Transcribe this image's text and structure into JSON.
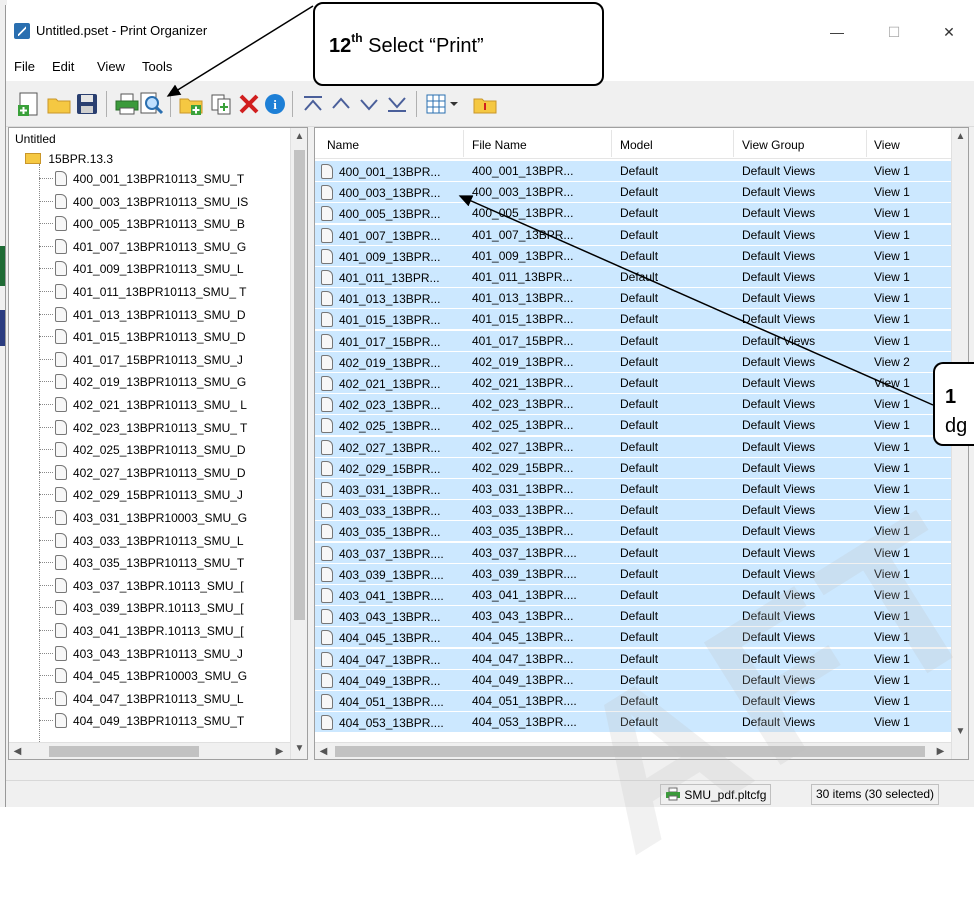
{
  "window": {
    "title": "Untitled.pset - Print Organizer",
    "minimize": "—",
    "maximize": "☐",
    "close": "✕"
  },
  "menu": [
    "File",
    "Edit",
    "View",
    "Tools"
  ],
  "toolbar": {
    "icons": [
      "new-icon",
      "open-icon",
      "save-icon",
      "print-icon",
      "preview-icon",
      "add-folder-icon",
      "add-files-icon",
      "delete-icon",
      "properties-icon",
      "move-top-icon",
      "move-up-icon",
      "move-down-icon",
      "move-bottom-icon",
      "columns-icon",
      "help-icon"
    ]
  },
  "callouts": {
    "step12_number": "12",
    "step12_suffix": "th",
    "step12_text": " Select “Print”",
    "step11_partial_top": "1",
    "step11_partial_bottom": "dg"
  },
  "tree": {
    "root": "Untitled",
    "project": "15BPR.13.3",
    "items": [
      "400_001_13BPR10113_SMU_T",
      "400_003_13BPR10113_SMU_IS",
      "400_005_13BPR10113_SMU_B",
      "401_007_13BPR10113_SMU_G",
      "401_009_13BPR10113_SMU_L",
      "401_011_13BPR10113_SMU_ T",
      "401_013_13BPR10113_SMU_D",
      "401_015_13BPR10113_SMU_D",
      "401_017_15BPR10113_SMU_J",
      "402_019_13BPR10113_SMU_G",
      "402_021_13BPR10113_SMU_ L",
      "402_023_13BPR10113_SMU_ T",
      "402_025_13BPR10113_SMU_D",
      "402_027_13BPR10113_SMU_D",
      "402_029_15BPR10113_SMU_J",
      "403_031_13BPR10003_SMU_G",
      "403_033_13BPR10113_SMU_L",
      "403_035_13BPR10113_SMU_T",
      "403_037_13BPR.10113_SMU_[",
      "403_039_13BPR.10113_SMU_[",
      "403_041_13BPR.10113_SMU_[",
      "403_043_13BPR10113_SMU_J",
      "404_045_13BPR10003_SMU_G",
      "404_047_13BPR10113_SMU_L",
      "404_049_13BPR10113_SMU_T"
    ]
  },
  "list": {
    "columns": [
      "Name",
      "File Name",
      "Model",
      "View Group",
      "View"
    ],
    "rows": [
      [
        "400_001_13BPR...",
        "400_001_13BPR...",
        "Default",
        "Default Views",
        "View 1"
      ],
      [
        "400_003_13BPR...",
        "400_003_13BPR...",
        "Default",
        "Default Views",
        "View 1"
      ],
      [
        "400_005_13BPR...",
        "400_005_13BPR...",
        "Default",
        "Default Views",
        "View 1"
      ],
      [
        "401_007_13BPR...",
        "401_007_13BPR...",
        "Default",
        "Default Views",
        "View 1"
      ],
      [
        "401_009_13BPR...",
        "401_009_13BPR...",
        "Default",
        "Default Views",
        "View 1"
      ],
      [
        "401_011_13BPR...",
        "401_011_13BPR...",
        "Default",
        "Default Views",
        "View 1"
      ],
      [
        "401_013_13BPR...",
        "401_013_13BPR...",
        "Default",
        "Default Views",
        "View 1"
      ],
      [
        "401_015_13BPR...",
        "401_015_13BPR...",
        "Default",
        "Default Views",
        "View 1"
      ],
      [
        "401_017_15BPR...",
        "401_017_15BPR...",
        "Default",
        "Default Views",
        "View 1"
      ],
      [
        "402_019_13BPR...",
        "402_019_13BPR...",
        "Default",
        "Default Views",
        "View 2"
      ],
      [
        "402_021_13BPR...",
        "402_021_13BPR...",
        "Default",
        "Default Views",
        "View 1"
      ],
      [
        "402_023_13BPR...",
        "402_023_13BPR...",
        "Default",
        "Default Views",
        "View 1"
      ],
      [
        "402_025_13BPR...",
        "402_025_13BPR...",
        "Default",
        "Default Views",
        "View 1"
      ],
      [
        "402_027_13BPR...",
        "402_027_13BPR...",
        "Default",
        "Default Views",
        "View 1"
      ],
      [
        "402_029_15BPR...",
        "402_029_15BPR...",
        "Default",
        "Default Views",
        "View 1"
      ],
      [
        "403_031_13BPR...",
        "403_031_13BPR...",
        "Default",
        "Default Views",
        "View 1"
      ],
      [
        "403_033_13BPR...",
        "403_033_13BPR...",
        "Default",
        "Default Views",
        "View 1"
      ],
      [
        "403_035_13BPR...",
        "403_035_13BPR...",
        "Default",
        "Default Views",
        "View 1"
      ],
      [
        "403_037_13BPR....",
        "403_037_13BPR....",
        "Default",
        "Default Views",
        "View 1"
      ],
      [
        "403_039_13BPR....",
        "403_039_13BPR....",
        "Default",
        "Default Views",
        "View 1"
      ],
      [
        "403_041_13BPR....",
        "403_041_13BPR....",
        "Default",
        "Default Views",
        "View 1"
      ],
      [
        "403_043_13BPR...",
        "403_043_13BPR...",
        "Default",
        "Default Views",
        "View 1"
      ],
      [
        "404_045_13BPR...",
        "404_045_13BPR...",
        "Default",
        "Default Views",
        "View 1"
      ],
      [
        "404_047_13BPR...",
        "404_047_13BPR...",
        "Default",
        "Default Views",
        "View 1"
      ],
      [
        "404_049_13BPR...",
        "404_049_13BPR...",
        "Default",
        "Default Views",
        "View 1"
      ],
      [
        "404_051_13BPR....",
        "404_051_13BPR....",
        "Default",
        "Default Views",
        "View 1"
      ],
      [
        "404_053_13BPR....",
        "404_053_13BPR....",
        "Default",
        "Default Views",
        "View 1"
      ]
    ]
  },
  "status": {
    "config": "SMU_pdf.pltcfg",
    "count": "30 items (30 selected)"
  },
  "colors": {
    "selection": "#cce8ff",
    "folder": "#f5c842",
    "delete": "#d11f1f",
    "toolbar_blue": "#2a6fb0"
  }
}
